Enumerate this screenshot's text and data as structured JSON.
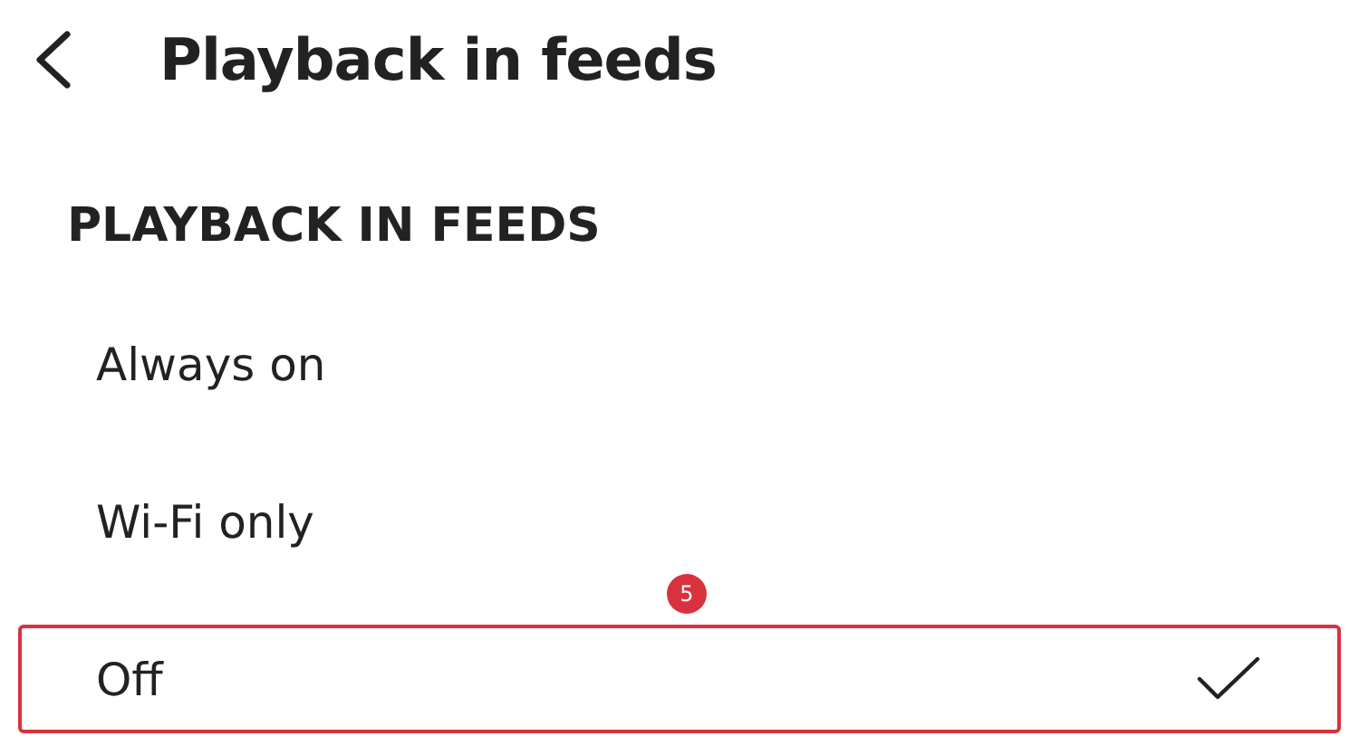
{
  "header": {
    "title": "Playback in feeds"
  },
  "section_title": "PLAYBACK IN FEEDS",
  "options": [
    {
      "label": "Always on",
      "selected": false,
      "highlighted": false
    },
    {
      "label": "Wi-Fi only",
      "selected": false,
      "highlighted": false
    },
    {
      "label": "Off",
      "selected": true,
      "highlighted": true,
      "step": "5"
    }
  ]
}
